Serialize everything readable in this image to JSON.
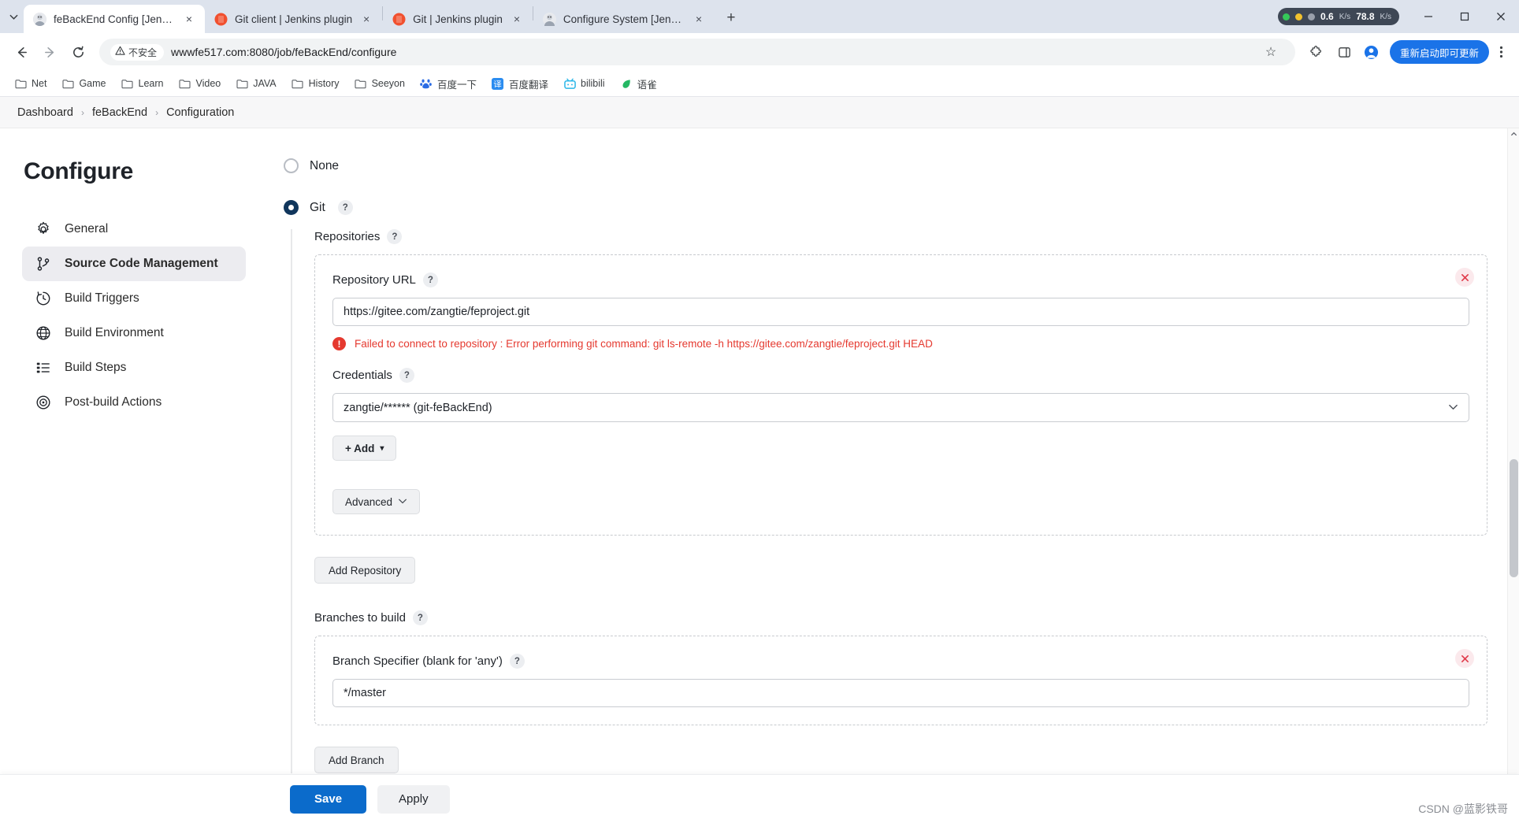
{
  "browser": {
    "tabs": [
      {
        "title": "feBackEnd Config [Jenkins]",
        "favicon": "jenkins-icon",
        "active": true,
        "close": "×"
      },
      {
        "title": "Git client | Jenkins plugin",
        "favicon": "git-icon",
        "active": false,
        "close": "×"
      },
      {
        "title": "Git | Jenkins plugin",
        "favicon": "git-icon",
        "active": false,
        "close": "×"
      },
      {
        "title": "Configure System [Jenkins]",
        "favicon": "jenkins-icon",
        "active": false,
        "close": "×"
      }
    ],
    "tab_list_icon": "chevron-down-icon",
    "new_tab_label": "+",
    "net_meter": {
      "up_value": "0.6",
      "up_unit": "K/s",
      "down_value": "78.8",
      "down_unit": "K/s"
    },
    "window_controls": {
      "minimize": "—",
      "maximize": "☐",
      "close": "✕"
    },
    "toolbar": {
      "back": "←",
      "forward": "→",
      "reload": "↻",
      "security_label": "不安全",
      "security_icon": "warning-triangle-icon",
      "url": "wwwfe517.com:8080/job/feBackEnd/configure",
      "bookmark_star": "☆",
      "extensions_icon": "puzzle-icon",
      "sidepanel_icon": "side-panel-icon",
      "profile_icon": "account-icon",
      "update_label": "重新启动即可更新",
      "menu_icon": "kebab-menu-icon"
    },
    "bookmarks": [
      {
        "label": "Net",
        "icon": "folder-icon"
      },
      {
        "label": "Game",
        "icon": "folder-icon"
      },
      {
        "label": "Learn",
        "icon": "folder-icon"
      },
      {
        "label": "Video",
        "icon": "folder-icon"
      },
      {
        "label": "JAVA",
        "icon": "folder-icon"
      },
      {
        "label": "History",
        "icon": "folder-icon"
      },
      {
        "label": "Seeyon",
        "icon": "folder-icon"
      },
      {
        "label": "百度一下",
        "icon": "baidu-icon"
      },
      {
        "label": "百度翻译",
        "icon": "baidu-translate-icon"
      },
      {
        "label": "bilibili",
        "icon": "bilibili-icon"
      },
      {
        "label": "语雀",
        "icon": "yuque-icon"
      }
    ]
  },
  "breadcrumb": {
    "items": [
      "Dashboard",
      "feBackEnd",
      "Configuration"
    ],
    "separator": "›"
  },
  "sidebar": {
    "title": "Configure",
    "items": [
      {
        "label": "General",
        "icon": "gear-icon",
        "active": false
      },
      {
        "label": "Source Code Management",
        "icon": "branch-icon",
        "active": true
      },
      {
        "label": "Build Triggers",
        "icon": "clock-icon",
        "active": false
      },
      {
        "label": "Build Environment",
        "icon": "globe-icon",
        "active": false
      },
      {
        "label": "Build Steps",
        "icon": "list-icon",
        "active": false
      },
      {
        "label": "Post-build Actions",
        "icon": "target-icon",
        "active": false
      }
    ]
  },
  "main": {
    "scm_options": [
      {
        "label": "None",
        "selected": false,
        "has_help": false
      },
      {
        "label": "Git",
        "selected": true,
        "has_help": true
      }
    ],
    "help_glyph": "?",
    "repositories": {
      "label": "Repositories",
      "repo_url": {
        "label": "Repository URL",
        "value": "https://gitee.com/zangtie/feproject.git"
      },
      "error": "Failed to connect to repository : Error performing git command: git ls-remote -h https://gitee.com/zangtie/feproject.git HEAD",
      "error_icon": "error-circle-icon",
      "credentials": {
        "label": "Credentials",
        "value": "zangtie/****** (git-feBackEnd)"
      },
      "add_credentials_label": "+ Add",
      "add_credentials_caret": "▾",
      "advanced_label": "Advanced",
      "advanced_caret": "⌄",
      "delete_icon": "delete-repo-icon",
      "add_repository_label": "Add Repository"
    },
    "branches": {
      "label": "Branches to build",
      "specifier": {
        "label": "Branch Specifier (blank for 'any')",
        "value": "*/master"
      },
      "delete_icon": "delete-branch-icon",
      "add_branch_label": "Add Branch"
    }
  },
  "footer": {
    "save_label": "Save",
    "apply_label": "Apply"
  },
  "watermark": "CSDN @蓝影铁哥",
  "colors": {
    "accent": "#0b6bcb",
    "radio_selected": "#10365c",
    "error": "#e5392f",
    "update_pill": "#1a73e8"
  }
}
